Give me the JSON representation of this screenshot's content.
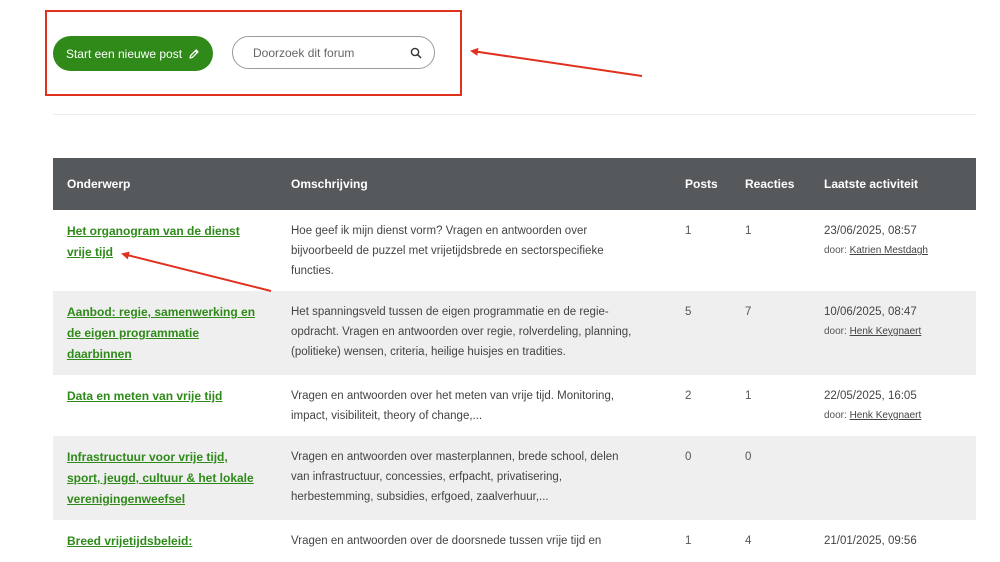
{
  "toolbar": {
    "new_post_label": "Start een nieuwe post",
    "search_placeholder": "Doorzoek dit forum"
  },
  "table": {
    "headers": [
      "Onderwerp",
      "Omschrijving",
      "Posts",
      "Reacties",
      "Laatste activiteit"
    ],
    "rows": [
      {
        "topic": "Het organogram van de dienst vrije tijd",
        "description": "Hoe geef ik mijn dienst vorm? Vragen en antwoorden over bijvoorbeeld de puzzel met vrijetijdsbrede en sectorspecifieke functies.",
        "posts": "1",
        "reactions": "1",
        "last_date": "23/06/2025, 08:57",
        "by_label": "door:",
        "author": "Katrien Mestdagh"
      },
      {
        "topic": "Aanbod: regie, samenwerking en de eigen programmatie daarbinnen",
        "description": "Het spanningsveld tussen de eigen programmatie en de regie-opdracht. Vragen en antwoorden over regie, rolverdeling, planning, (politieke) wensen, criteria, heilige huisjes en tradities.",
        "posts": "5",
        "reactions": "7",
        "last_date": "10/06/2025, 08:47",
        "by_label": "door:",
        "author": "Henk Keygnaert"
      },
      {
        "topic": "Data en meten van vrije tijd",
        "description": "Vragen en antwoorden over het meten van vrije tijd. Monitoring, impact, visibiliteit, theory of change,...",
        "posts": "2",
        "reactions": "1",
        "last_date": "22/05/2025, 16:05",
        "by_label": "door:",
        "author": "Henk Keygnaert"
      },
      {
        "topic": "Infrastructuur voor vrije tijd, sport, jeugd, cultuur & het lokale verenigingenweefsel",
        "description": "Vragen en antwoorden over masterplannen, brede school, delen van infrastructuur, concessies, erfpacht, privatisering, herbestemming, subsidies, erfgoed, zaalverhuur,...",
        "posts": "0",
        "reactions": "0",
        "last_date": "",
        "by_label": "",
        "author": ""
      },
      {
        "topic": "Breed vrijetijdsbeleid:",
        "description": "Vragen en antwoorden over de doorsnede tussen vrije tijd en",
        "posts": "1",
        "reactions": "4",
        "last_date": "21/01/2025, 09:56",
        "by_label": "",
        "author": ""
      }
    ]
  },
  "colors": {
    "accent_green": "#2f8a1a",
    "header_bg": "#55595c",
    "annotation_red": "#e0301e"
  }
}
